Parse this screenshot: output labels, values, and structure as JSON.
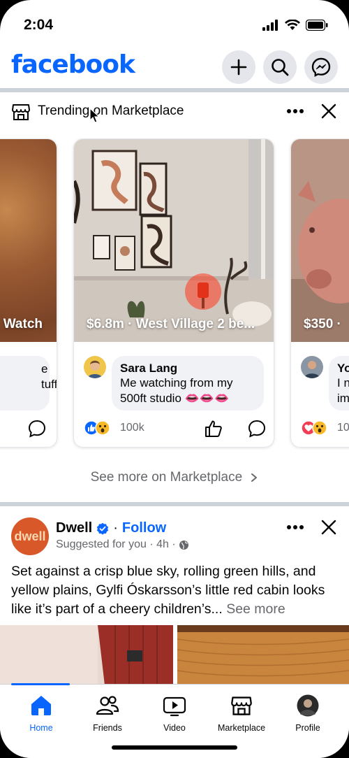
{
  "status_bar": {
    "time": "2:04"
  },
  "header": {
    "logo": "facebook",
    "icons": [
      "plus-icon",
      "search-icon",
      "messenger-icon"
    ]
  },
  "trending": {
    "title": "Trending on Marketplace",
    "cards": [
      {
        "price": "Watch",
        "comment_text": [
          "e",
          "tuff"
        ],
        "count": ""
      },
      {
        "price": "$6.8m · West Village 2 be...",
        "commenter": "Sara Lang",
        "comment": "Me watching from my 500ft studio 👄👄👄",
        "count": "100k"
      },
      {
        "price": "$350 ·",
        "commenter": "Yo",
        "comment_text": [
          "I n",
          "im"
        ],
        "count": "10"
      }
    ],
    "see_more": "See more on Marketplace"
  },
  "post": {
    "avatar_text": "dwell",
    "name": "Dwell",
    "follow": "Follow",
    "dot": "·",
    "meta": "Suggested for you · 4h ·",
    "text": "Set against a crisp blue sky, rolling green hills, and yellow plains, Gylfi Óskarsson’s little red cabin looks like it’s part of a cheery children’s...",
    "see_more": "See more"
  },
  "tabs": [
    {
      "label": "Home",
      "active": true
    },
    {
      "label": "Friends"
    },
    {
      "label": "Video"
    },
    {
      "label": "Marketplace"
    },
    {
      "label": "Profile"
    }
  ],
  "colors": {
    "brand": "#0866ff",
    "secondary_text": "#65676b",
    "divider": "#cbd2d9"
  }
}
